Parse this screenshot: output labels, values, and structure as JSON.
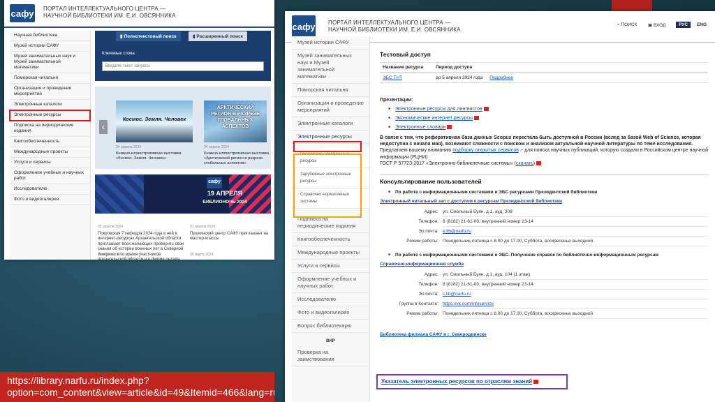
{
  "shot1": {
    "portal_title": "ПОРТАЛ ИНТЕЛЛЕКТУАЛЬНОГО ЦЕНТРА —",
    "portal_subtitle": "НАУЧНОЙ БИБЛИОТЕКИ ИМ. Е.И. ОВСЯННИКА",
    "logo_text": "сафу",
    "sidebar": [
      "Научная библиотека",
      "Музей истории САФУ",
      "Музей занимательных наук и Музей занимательной математики",
      "Поморская читальня",
      "Организация и проведение мероприятий",
      "Электронные каталоги",
      "Электронные ресурсы",
      "Подписка на периодические издания",
      "Книгообеспеченность",
      "Международные проекты",
      "Услуги и сервисы",
      "Оформление учебных и научных работ",
      "Исследователю",
      "Фото и видеогалерея"
    ],
    "tab_simple": "Полнотекстовый поиск",
    "tab_advanced": "Расширенный поиск",
    "search_label": "Ключевые слова",
    "search_placeholder": "Введите текст запроса",
    "slide1_title": "Космос. Земля. Человек",
    "slide1_date": "04 апреля 2024",
    "slide1_caption": "Книжно-иллюстративная выставка «Космос. Земля. Человек»",
    "slide2_title": "АРКТИЧЕСКИЙ РЕГИОН В РАЗРЕЗЕ ГЛОБАЛЬНЫХ АСПЕКТОВ",
    "slide2_date": "04 апреля 2024",
    "slide2_caption": "Книжно-иллюстративная выставка «Арктический регион в разрезе глобальных аспектов»",
    "banner_date": "19 АПРЕЛЯ",
    "banner_event": "БИБЛИОНОЧЬ 2024",
    "news1_date": "03 апреля 2024",
    "news1_text": "Покровская 7 кафедра 2024 года в ней в интернет-ресурсах Архангельской области приглашает всех желающих проверить свои знания об истории военных лет в Северной Америке, в то время участников Архангельской области и в форме онлайн викторин",
    "news2_date": "01 апреля 2024",
    "news2_text": "Пушкинский центр САФУ приглашает на мастер-классы",
    "news3_date": "29 марта 2024",
    "news4_date": "28 марта 2024"
  },
  "shot2": {
    "portal_title": "ПОРТАЛ ИНТЕЛЛЕКТУАЛЬНОГО ЦЕНТРА —",
    "portal_subtitle": "НАУЧНОЙ БИБЛИОТЕКИ ИМ. Е.И. ОВСЯННИКА",
    "logo_text": "сафу",
    "nav_search": "ПОИСК",
    "nav_login": "ВХОД",
    "lang_ru": "РУС",
    "lang_en": "ENG",
    "sidebar": [
      "Музей истории САФУ",
      "Музей занимательных наук и Музей занимательной математики",
      "Поморская читальня",
      "Организация и проведение мероприятий",
      "Электронные каталоги",
      "Электронные ресурсы"
    ],
    "sub_items": [
      "Российские электронные ресурсы",
      "Зарубежные электронные ресурсы",
      "Справочно-нормативные системы"
    ],
    "sidebar_after": [
      "Подписка на периодические издания",
      "Книгообеспеченность",
      "Международные проекты",
      "Услуги и сервисы",
      "Оформление учебных и научных работ",
      "Исследователю",
      "Фото и видеогалерея",
      "Вопрос библиотекарю"
    ],
    "vkr_label": "ВКР",
    "vkr_item": "Проверка на заимствования",
    "test_access_title": "Тестовый доступ",
    "col_resource": "Название ресурса",
    "col_period": "Период доступа",
    "res_name": "ЭБС ТНТ",
    "res_period": "до 5 апреля 2024 года",
    "res_more": "Подробнее",
    "presentations_title": "Презентации:",
    "pres_items": [
      "Электронные ресурсы для лингвистов",
      "Экономические интернет ресурсы",
      "Электронные словари"
    ],
    "para1": "В связи с тем, что реферативная база данных Scopus перестала быть доступной в России (вслед за базой Web of Science, которая недоступна с начала мая), возникают сложности с поиском и анализом актуальной научной литературы по теме исследования.",
    "para2_pre": "Предлагаем вашему вниманию",
    "para2_link": "подборку открытых сервисов",
    "para2_post": "для поиска научных публикаций, которую создали в Российском центре научной информации (РЦНИ)",
    "gost": "ГОСТ Р 57723-2017 «Электронно-библиотечные системы»",
    "gost_link": "скачать",
    "consult_title": "Консультирование пользователей",
    "consult_b1": "По работе с информационными системами и ЭБС ресурсами Президентской библиотеки",
    "consult_link1": "Электронный читальный зал с доступом к ресурсам Президентской библиотеки",
    "c1_addr_l": "Адрес:",
    "c1_addr": "ул. Смольный Буян, д.1, ауд. 308",
    "c1_phone_l": "Телефон:",
    "c1_phone": "8 (8182) 21-61-00, внутренний номер 23-14",
    "c1_mail_l": "Эл.почта:",
    "c1_mail": "e.lib@narfu.ru",
    "c1_hours_l": "Режим работы:",
    "c1_hours": "Понедельник-пятница с 8.00 до 17.00, Суббота, воскресенье выходной",
    "consult_b2": "По работе с информационными системами и ЭБС. Получение справок по библиотечно-информационным ресурсам",
    "consult_link2": "Справочно-информационная служба",
    "c2_addr_l": "Адрес:",
    "c2_addr": "ул. Смольный Буян, д.1, ауд. 104 (1 этаж)",
    "c2_phone_l": "Телефон:",
    "c2_phone": "8 (8182) 21-61-00, внутренний номер 23-14",
    "c2_mail_l": "Эл.почта:",
    "c2_mail": "c.lib@narfu.ru",
    "c2_vk_l": "Группа в Контакте:",
    "c2_vk": "https://vk.com/infoservice",
    "c2_hours_l": "Режим работы:",
    "c2_hours": "Понедельник-пятница с 8.00 до 17.00, Суббота, воскресенье выходной",
    "branch_link": "Библиотека филиала САФУ в г. Северодвинске",
    "index_link": "Указатель электронных ресурсов по отраслям знаний"
  },
  "url_caption": "https://library.narfu.ru/index.php?option=com_content&view=article&id=49&Itemid=466&lang=ru"
}
